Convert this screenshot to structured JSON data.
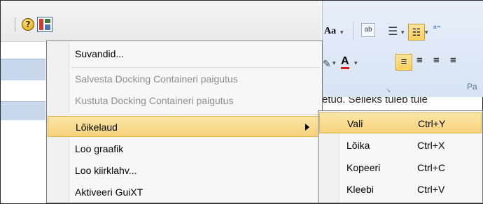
{
  "toolbar": {
    "help_glyph": "?",
    "icons": [
      "help-icon",
      "customize-layout-icon"
    ]
  },
  "ribbon": {
    "font_grow_label": "Aa",
    "font_color_label": "A",
    "group_label": "Pa",
    "doc_text": "etud. Selleks tuleb tule"
  },
  "menu": {
    "items": [
      {
        "label": "Suvandid...",
        "enabled": true
      },
      {
        "label": "Salvesta Docking Containeri paigutus",
        "enabled": false
      },
      {
        "label": "Kustuta Docking Containeri paigutus",
        "enabled": false
      },
      {
        "label": "Lõikelaud",
        "enabled": true,
        "submenu": true,
        "highlighted": true
      },
      {
        "label": "Loo graafik",
        "enabled": true
      },
      {
        "label": "Loo kiirklahv...",
        "enabled": true
      },
      {
        "label": "Aktiveeri GuiXT",
        "enabled": true
      }
    ]
  },
  "submenu": {
    "items": [
      {
        "label": "Vali",
        "shortcut": "Ctrl+Y",
        "highlighted": true
      },
      {
        "label": "Lõika",
        "shortcut": "Ctrl+X"
      },
      {
        "label": "Kopeeri",
        "shortcut": "Ctrl+C"
      },
      {
        "label": "Kleebi",
        "shortcut": "Ctrl+V"
      }
    ]
  },
  "colors": {
    "highlight": "#f6d27c",
    "disabled_text": "#8d8d8d",
    "ribbon_bg": "#d7e4f3"
  }
}
